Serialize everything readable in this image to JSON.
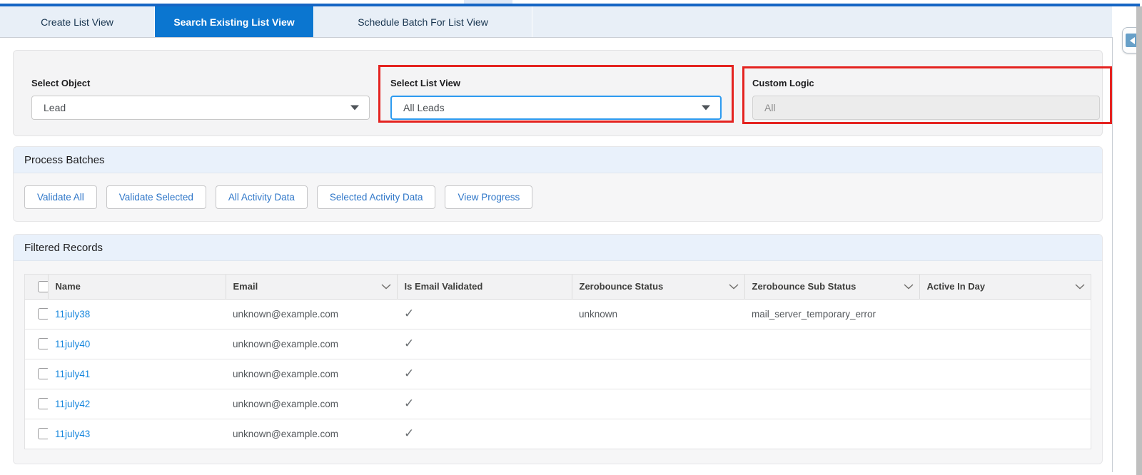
{
  "tabs": [
    {
      "label": "Create List View",
      "active": false
    },
    {
      "label": "Search Existing List View",
      "active": true
    },
    {
      "label": "Schedule Batch For List View",
      "active": false
    }
  ],
  "form": {
    "select_object": {
      "label": "Select Object",
      "value": "Lead"
    },
    "select_list_view": {
      "label": "Select List View",
      "value": "All Leads"
    },
    "custom_logic": {
      "label": "Custom Logic",
      "value": "All"
    }
  },
  "process_batches": {
    "title": "Process Batches",
    "buttons": [
      "Validate All",
      "Validate Selected",
      "All Activity Data",
      "Selected Activity Data",
      "View Progress"
    ]
  },
  "filtered_records": {
    "title": "Filtered Records",
    "columns": [
      {
        "label": "Name",
        "chevron": false
      },
      {
        "label": "Email",
        "chevron": true
      },
      {
        "label": "Is Email Validated",
        "chevron": false
      },
      {
        "label": "Zerobounce Status",
        "chevron": true
      },
      {
        "label": "Zerobounce Sub Status",
        "chevron": true
      },
      {
        "label": "Active In Day",
        "chevron": true
      }
    ],
    "rows": [
      {
        "name": "11july38",
        "email": "unknown@example.com",
        "validated": "✓",
        "status": "unknown",
        "sub_status": "mail_server_temporary_error",
        "active_in_day": ""
      },
      {
        "name": "11july40",
        "email": "unknown@example.com",
        "validated": "✓",
        "status": "",
        "sub_status": "",
        "active_in_day": ""
      },
      {
        "name": "11july41",
        "email": "unknown@example.com",
        "validated": "✓",
        "status": "",
        "sub_status": "",
        "active_in_day": ""
      },
      {
        "name": "11july42",
        "email": "unknown@example.com",
        "validated": "✓",
        "status": "",
        "sub_status": "",
        "active_in_day": ""
      },
      {
        "name": "11july43",
        "email": "unknown@example.com",
        "validated": "✓",
        "status": "",
        "sub_status": "",
        "active_in_day": ""
      }
    ]
  },
  "icons": {
    "dropdown_arrow": "triangle-down",
    "column_chevron": "chevron-down",
    "row_check": "check",
    "panel_collapse": "triangle-left"
  },
  "colors": {
    "accent_blue": "#0b76d0",
    "top_line_blue": "#1565c4",
    "tabbar_bg": "#e8eff7",
    "section_header_bg": "#e9f1fb",
    "annotation_red": "#e42320",
    "link_blue": "#1787dd",
    "focused_border": "#2d9bf0"
  }
}
